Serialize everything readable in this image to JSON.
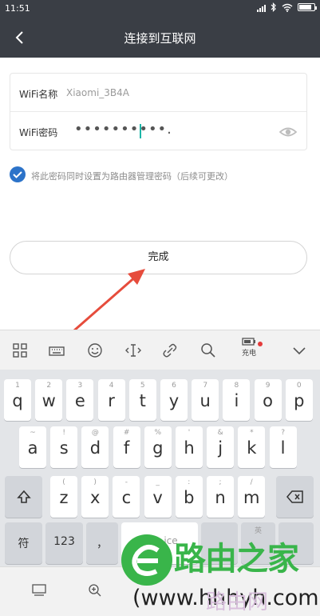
{
  "status_bar": {
    "time": "11:51",
    "battery_level": 0.85,
    "icons": [
      "signal-icon",
      "bluetooth-icon",
      "wifi-icon",
      "battery-icon"
    ]
  },
  "nav": {
    "back_icon": "back-chevron-icon",
    "title": "连接到互联网"
  },
  "form": {
    "wifi_name_label": "WiFi名称",
    "wifi_name_value": "Xiaomi_3B4A",
    "wifi_password_label": "WiFi密码",
    "wifi_password_value": "••••••••••.",
    "eye_icon": "eye-icon"
  },
  "checkbox": {
    "checked": true,
    "label": "将此密码同时设置为路由器管理密码（后续可更改）"
  },
  "done_button": {
    "label": "完成"
  },
  "annotation": {
    "color": "#e64c3c"
  },
  "keyboard_toolbar": {
    "items": [
      "grid-icon",
      "keyboard-icon",
      "emoji-icon",
      "cursor-icon",
      "clipboard-icon",
      "search-icon",
      "battery-charge-icon",
      "collapse-icon"
    ],
    "charge_label": "充电"
  },
  "keyboard": {
    "row1": [
      {
        "hint": "1",
        "char": "q"
      },
      {
        "hint": "2",
        "char": "w"
      },
      {
        "hint": "3",
        "char": "e"
      },
      {
        "hint": "4",
        "char": "r"
      },
      {
        "hint": "5",
        "char": "t"
      },
      {
        "hint": "6",
        "char": "y"
      },
      {
        "hint": "7",
        "char": "u"
      },
      {
        "hint": "8",
        "char": "i"
      },
      {
        "hint": "9",
        "char": "o"
      },
      {
        "hint": "0",
        "char": "p"
      }
    ],
    "row2": [
      {
        "hint": "~",
        "char": "a"
      },
      {
        "hint": "!",
        "char": "s"
      },
      {
        "hint": "@",
        "char": "d"
      },
      {
        "hint": "#",
        "char": "f"
      },
      {
        "hint": "%",
        "char": "g"
      },
      {
        "hint": "'",
        "char": "h"
      },
      {
        "hint": "&",
        "char": "j"
      },
      {
        "hint": "*",
        "char": "k"
      },
      {
        "hint": "?",
        "char": "l"
      }
    ],
    "row3": [
      {
        "hint": "(",
        "char": "z"
      },
      {
        "hint": ")",
        "char": "x"
      },
      {
        "hint": "-",
        "char": "c"
      },
      {
        "hint": "_",
        "char": "v"
      },
      {
        "hint": ":",
        "char": "b"
      },
      {
        "hint": ";",
        "char": "n"
      },
      {
        "hint": "/",
        "char": "m"
      }
    ],
    "shift_icon": "shift-icon",
    "delete_icon": "backspace-icon",
    "symbol_label": "符",
    "number_label": "123",
    "comma_label": "，",
    "space_hint": "ice",
    "lang_hint": "英"
  },
  "bottom_bar": {
    "icons": [
      "keyboard-hide-icon",
      "zoom-icon"
    ]
  },
  "watermark": {
    "brand": "路由之家",
    "url": "(www.hhhyh.com",
    "ghost_text": "路由网"
  }
}
